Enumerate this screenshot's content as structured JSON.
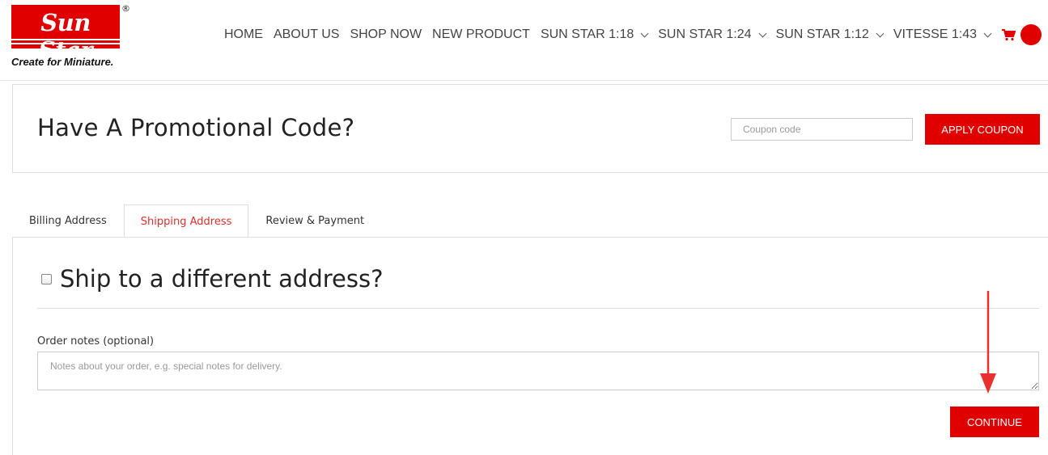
{
  "brand": {
    "name": "Sun Star",
    "registered_mark": "®",
    "tagline": "Create for Miniature.",
    "color": "#e00000"
  },
  "nav": {
    "items": [
      {
        "label": "HOME",
        "dropdown": false
      },
      {
        "label": "ABOUT US",
        "dropdown": false
      },
      {
        "label": "SHOP NOW",
        "dropdown": false
      },
      {
        "label": "NEW PRODUCT",
        "dropdown": false
      },
      {
        "label": "SUN STAR 1:18",
        "dropdown": true
      },
      {
        "label": "SUN STAR 1:24",
        "dropdown": true
      },
      {
        "label": "SUN STAR 1:12",
        "dropdown": true
      },
      {
        "label": "VITESSE 1:43",
        "dropdown": true
      }
    ],
    "cart_icon": "cart-icon"
  },
  "coupon": {
    "title": "Have A Promotional Code?",
    "placeholder": "Coupon code",
    "value": "",
    "button_label": "APPLY COUPON"
  },
  "checkout": {
    "tabs": [
      {
        "label": "Billing Address",
        "active": false
      },
      {
        "label": "Shipping Address",
        "active": true
      },
      {
        "label": "Review & Payment",
        "active": false
      }
    ],
    "ship_different_label": "Ship to a different address?",
    "ship_different_checked": false,
    "notes_label": "Order notes (optional)",
    "notes_placeholder": "Notes about your order, e.g. special notes for delivery.",
    "notes_value": "",
    "continue_label": "CONTINUE"
  },
  "colors": {
    "accent": "#e00000",
    "active_tab_text": "#d9302b",
    "annotation_arrow": "#e8312f"
  }
}
